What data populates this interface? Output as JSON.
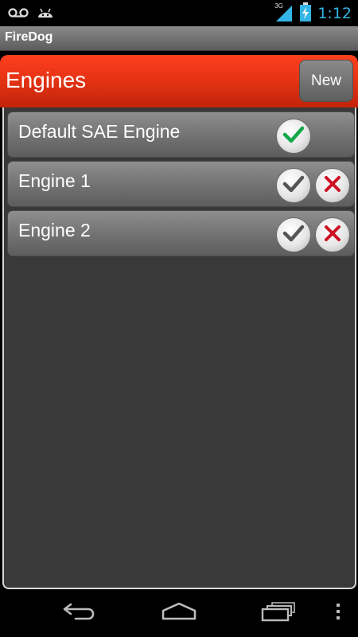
{
  "status_bar": {
    "network_type": "3G",
    "time": "1:12",
    "icons": [
      "voicemail-icon",
      "android-icon",
      "signal-icon",
      "battery-charging-icon"
    ]
  },
  "app_bar": {
    "title": "FireDog"
  },
  "header": {
    "title": "Engines",
    "new_button_label": "New"
  },
  "engines": [
    {
      "name": "Default SAE Engine",
      "selected": true,
      "deletable": false
    },
    {
      "name": "Engine 1",
      "selected": false,
      "deletable": true
    },
    {
      "name": "Engine 2",
      "selected": false,
      "deletable": true
    }
  ],
  "colors": {
    "header_red": "#e63414",
    "check_active": "#14a84a",
    "check_inactive": "#555555",
    "delete_red": "#cc1122",
    "status_blue": "#33b5e5"
  },
  "nav_bar": {
    "icons": [
      "back-icon",
      "home-icon",
      "recent-apps-icon",
      "overflow-menu-icon"
    ]
  }
}
